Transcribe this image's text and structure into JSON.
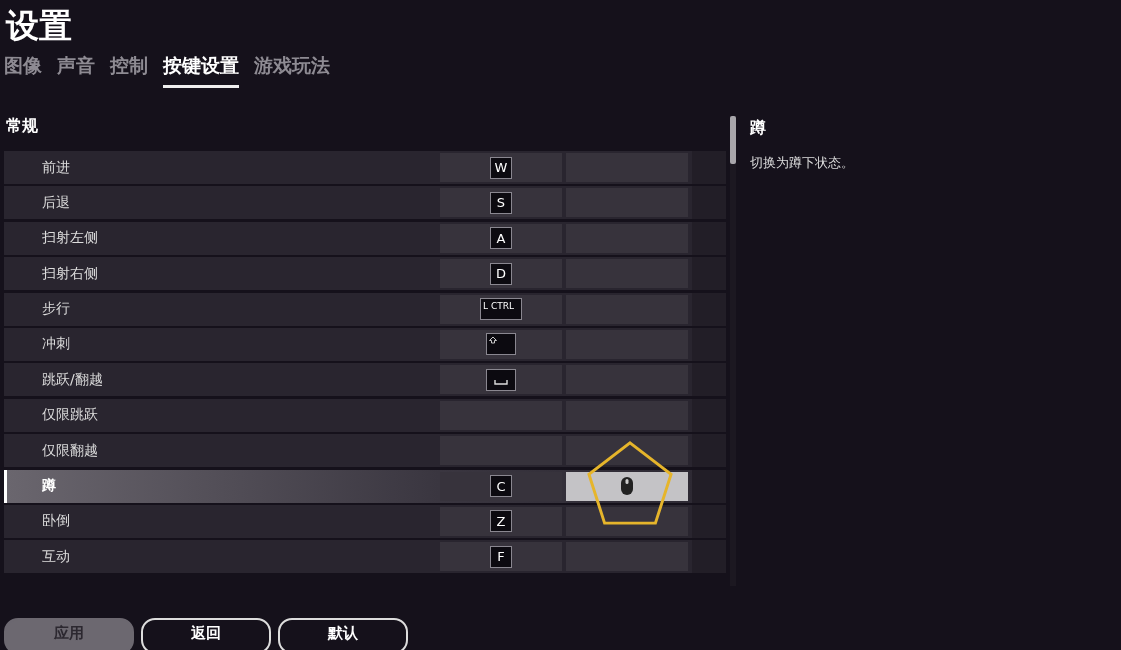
{
  "title": "设置",
  "tabs": [
    {
      "label": "图像",
      "selected": false
    },
    {
      "label": "声音",
      "selected": false
    },
    {
      "label": "控制",
      "selected": false
    },
    {
      "label": "按键设置",
      "selected": true
    },
    {
      "label": "游戏玩法",
      "selected": false
    }
  ],
  "section": "常规",
  "rows": [
    {
      "label": "前进",
      "selected": false,
      "primary": {
        "kind": "key",
        "text": "W"
      },
      "secondary": {
        "kind": "none"
      }
    },
    {
      "label": "后退",
      "selected": false,
      "primary": {
        "kind": "key",
        "text": "S"
      },
      "secondary": {
        "kind": "none"
      }
    },
    {
      "label": "扫射左侧",
      "selected": false,
      "primary": {
        "kind": "key",
        "text": "A"
      },
      "secondary": {
        "kind": "none"
      }
    },
    {
      "label": "扫射右侧",
      "selected": false,
      "primary": {
        "kind": "key",
        "text": "D"
      },
      "secondary": {
        "kind": "none"
      }
    },
    {
      "label": "步行",
      "selected": false,
      "primary": {
        "kind": "wide",
        "text": "L CTRL"
      },
      "secondary": {
        "kind": "none"
      }
    },
    {
      "label": "冲刺",
      "selected": false,
      "primary": {
        "kind": "shift"
      },
      "secondary": {
        "kind": "none"
      }
    },
    {
      "label": "跳跃/翻越",
      "selected": false,
      "primary": {
        "kind": "space"
      },
      "secondary": {
        "kind": "none"
      }
    },
    {
      "label": "仅限跳跃",
      "selected": false,
      "primary": {
        "kind": "none"
      },
      "secondary": {
        "kind": "none"
      }
    },
    {
      "label": "仅限翻越",
      "selected": false,
      "primary": {
        "kind": "none"
      },
      "secondary": {
        "kind": "none"
      }
    },
    {
      "label": "蹲",
      "selected": true,
      "primary": {
        "kind": "key",
        "text": "C"
      },
      "secondary": {
        "kind": "mouse"
      }
    },
    {
      "label": "卧倒",
      "selected": false,
      "primary": {
        "kind": "key",
        "text": "Z"
      },
      "secondary": {
        "kind": "none"
      }
    },
    {
      "label": "互动",
      "selected": false,
      "primary": {
        "kind": "key",
        "text": "F"
      },
      "secondary": {
        "kind": "none"
      }
    }
  ],
  "detail": {
    "title": "蹲",
    "text": "切换为蹲下状态。"
  },
  "buttons": [
    {
      "label": "应用",
      "disabled": true
    },
    {
      "label": "返回",
      "disabled": false
    },
    {
      "label": "默认",
      "disabled": false
    }
  ]
}
